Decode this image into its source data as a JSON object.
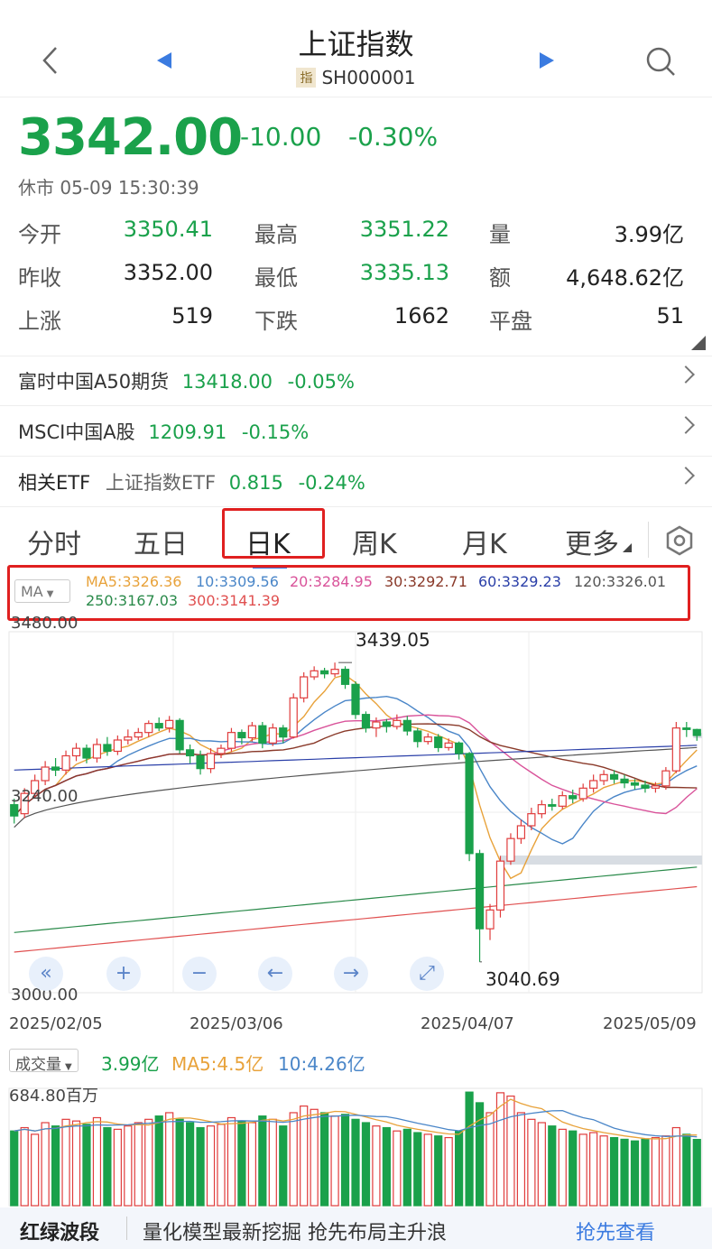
{
  "header": {
    "title": "上证指数",
    "code_tag": "指",
    "code": "SH000001"
  },
  "quote": {
    "price": "3342.00",
    "change": "-10.00",
    "change_pct": "-0.30%",
    "status_time": "休市 05-09 15:30:39"
  },
  "stats": [
    {
      "label": "今开",
      "value": "3350.41",
      "color": "green"
    },
    {
      "label": "最高",
      "value": "3351.22",
      "color": "green"
    },
    {
      "label": "量",
      "value": "3.99亿",
      "color": "dark"
    },
    {
      "label": "昨收",
      "value": "3352.00",
      "color": "dark"
    },
    {
      "label": "最低",
      "value": "3335.13",
      "color": "green"
    },
    {
      "label": "额",
      "value": "4,648.62亿",
      "color": "dark"
    },
    {
      "label": "上涨",
      "value": "519",
      "color": "dark"
    },
    {
      "label": "下跌",
      "value": "1662",
      "color": "dark"
    },
    {
      "label": "平盘",
      "value": "51",
      "color": "dark"
    }
  ],
  "related": [
    {
      "name": "富时中国A50期货",
      "value": "13418.00",
      "pct": "-0.05%"
    },
    {
      "name": "MSCI中国A股",
      "value": "1209.91",
      "pct": "-0.15%"
    },
    {
      "name": "相关ETF",
      "sub": "上证指数ETF",
      "value": "0.815",
      "pct": "-0.24%"
    }
  ],
  "tabs": [
    "分时",
    "五日",
    "日K",
    "周K",
    "月K",
    "更多"
  ],
  "active_tab": "日K",
  "ma": {
    "selector": "MA",
    "items": [
      {
        "text": "MA5:3326.36",
        "color": "#e8a23a"
      },
      {
        "text": "10:3309.56",
        "color": "#4a86c8"
      },
      {
        "text": "20:3284.95",
        "color": "#d9539a"
      },
      {
        "text": "30:3292.71",
        "color": "#8a3a2a"
      },
      {
        "text": "60:3329.23",
        "color": "#2a3fa8"
      },
      {
        "text": "120:3326.01",
        "color": "#555555"
      },
      {
        "text": "250:3167.03",
        "color": "#2a8a4a"
      },
      {
        "text": "300:3141.39",
        "color": "#e05050"
      }
    ]
  },
  "kline": {
    "y_top": "3480.00",
    "y_mid": "3240.00",
    "y_bottom": "3000.00",
    "high_label": "3439.05",
    "low_label": "3040.69",
    "dates": [
      "2025/02/05",
      "2025/03/06",
      "2025/04/07",
      "2025/05/09"
    ]
  },
  "volume": {
    "selector": "成交量",
    "current": "3.99亿",
    "ma5": "MA5:4.5亿",
    "ma10": "10:4.26亿",
    "y_top": "684.80百万"
  },
  "footer": {
    "tag": "红绿波段",
    "text": "量化模型最新挖掘 抢先布局主升浪",
    "action": "抢先查看"
  },
  "chart_data": {
    "type": "candlestick",
    "title": "上证指数 日K",
    "ylim": [
      3000,
      3480
    ],
    "candles": [
      [
        3250,
        3235,
        3258,
        3225
      ],
      [
        3238,
        3265,
        3272,
        3232
      ],
      [
        3265,
        3282,
        3290,
        3258
      ],
      [
        3282,
        3300,
        3308,
        3276
      ],
      [
        3300,
        3296,
        3312,
        3288
      ],
      [
        3296,
        3315,
        3322,
        3290
      ],
      [
        3315,
        3325,
        3332,
        3308
      ],
      [
        3325,
        3312,
        3330,
        3305
      ],
      [
        3312,
        3330,
        3338,
        3306
      ],
      [
        3330,
        3321,
        3340,
        3315
      ],
      [
        3321,
        3336,
        3342,
        3316
      ],
      [
        3336,
        3340,
        3350,
        3330
      ],
      [
        3340,
        3346,
        3352,
        3336
      ],
      [
        3346,
        3358,
        3362,
        3340
      ],
      [
        3358,
        3352,
        3366,
        3348
      ],
      [
        3352,
        3362,
        3368,
        3346
      ],
      [
        3362,
        3323,
        3365,
        3318
      ],
      [
        3323,
        3315,
        3330,
        3305
      ],
      [
        3315,
        3298,
        3322,
        3290
      ],
      [
        3298,
        3318,
        3325,
        3292
      ],
      [
        3318,
        3325,
        3330,
        3312
      ],
      [
        3325,
        3346,
        3352,
        3320
      ],
      [
        3346,
        3339,
        3350,
        3330
      ],
      [
        3339,
        3355,
        3360,
        3334
      ],
      [
        3355,
        3332,
        3360,
        3325
      ],
      [
        3332,
        3352,
        3358,
        3328
      ],
      [
        3352,
        3340,
        3356,
        3332
      ],
      [
        3340,
        3392,
        3398,
        3338
      ],
      [
        3392,
        3420,
        3426,
        3386
      ],
      [
        3420,
        3428,
        3434,
        3416
      ],
      [
        3428,
        3424,
        3432,
        3418
      ],
      [
        3424,
        3430,
        3439,
        3420
      ],
      [
        3430,
        3410,
        3434,
        3404
      ],
      [
        3410,
        3370,
        3414,
        3364
      ],
      [
        3370,
        3352,
        3374,
        3346
      ],
      [
        3352,
        3360,
        3366,
        3340
      ],
      [
        3360,
        3354,
        3364,
        3346
      ],
      [
        3354,
        3362,
        3370,
        3350
      ],
      [
        3362,
        3348,
        3368,
        3342
      ],
      [
        3348,
        3334,
        3352,
        3326
      ],
      [
        3334,
        3340,
        3345,
        3330
      ],
      [
        3340,
        3326,
        3344,
        3320
      ],
      [
        3326,
        3332,
        3338,
        3322
      ],
      [
        3332,
        3318,
        3334,
        3310
      ],
      [
        3318,
        3185,
        3320,
        3175
      ],
      [
        3185,
        3085,
        3190,
        3041
      ],
      [
        3085,
        3110,
        3118,
        3070
      ],
      [
        3110,
        3175,
        3182,
        3100
      ],
      [
        3175,
        3205,
        3212,
        3170
      ],
      [
        3205,
        3222,
        3230,
        3198
      ],
      [
        3222,
        3238,
        3246,
        3216
      ],
      [
        3238,
        3250,
        3256,
        3232
      ],
      [
        3250,
        3248,
        3258,
        3242
      ],
      [
        3248,
        3262,
        3268,
        3244
      ],
      [
        3262,
        3258,
        3270,
        3252
      ],
      [
        3258,
        3272,
        3278,
        3254
      ],
      [
        3272,
        3282,
        3290,
        3266
      ],
      [
        3282,
        3290,
        3296,
        3276
      ],
      [
        3290,
        3284,
        3296,
        3278
      ],
      [
        3284,
        3279,
        3290,
        3272
      ],
      [
        3279,
        3276,
        3284,
        3270
      ],
      [
        3276,
        3272,
        3282,
        3266
      ],
      [
        3272,
        3275,
        3280,
        3266
      ],
      [
        3275,
        3295,
        3300,
        3270
      ],
      [
        3295,
        3352,
        3360,
        3292
      ],
      [
        3352,
        3350,
        3360,
        3340
      ],
      [
        3350,
        3342,
        3351,
        3335
      ]
    ],
    "volume": [
      450,
      470,
      430,
      500,
      480,
      520,
      510,
      490,
      530,
      470,
      460,
      480,
      500,
      520,
      540,
      560,
      520,
      500,
      470,
      480,
      490,
      530,
      510,
      500,
      540,
      520,
      480,
      560,
      600,
      580,
      560,
      540,
      550,
      520,
      500,
      480,
      470,
      450,
      460,
      440,
      430,
      420,
      410,
      450,
      684,
      620,
      560,
      680,
      660,
      560,
      520,
      500,
      480,
      460,
      450,
      430,
      440,
      420,
      410,
      400,
      390,
      400,
      410,
      420,
      470,
      430,
      399
    ]
  }
}
